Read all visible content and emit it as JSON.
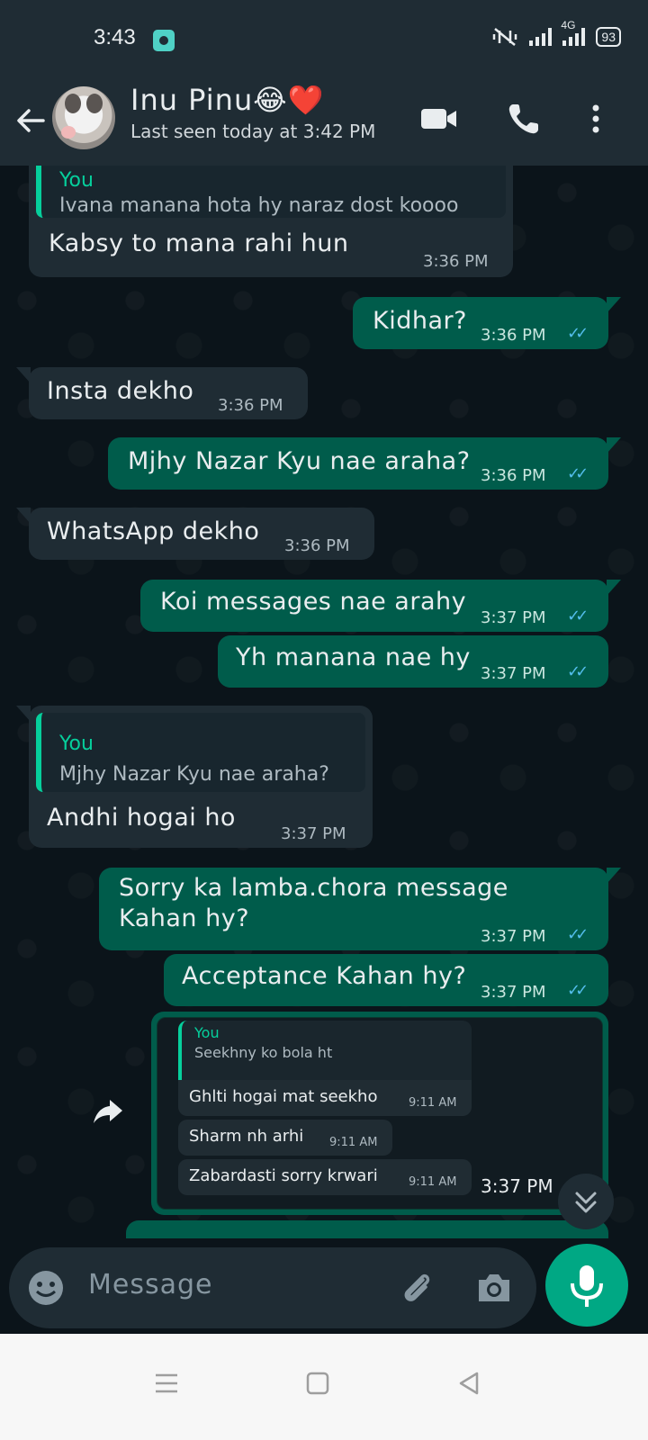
{
  "status_bar": {
    "time": "3:43",
    "network": "4G",
    "battery": "93"
  },
  "header": {
    "contact_name": "Inu Pinu😂❤️",
    "last_seen": "Last seen today at 3:42 PM",
    "icons": [
      "back-arrow-icon",
      "video-call-icon",
      "voice-call-icon",
      "more-options-icon"
    ]
  },
  "messages": [
    {
      "dir": "in",
      "quote_author": "You",
      "quote_text": "Ivana manana hota hy naraz dost koooo",
      "text": "Kabsy to mana rahi hun",
      "time": "3:36 PM"
    },
    {
      "dir": "out",
      "text": "Kidhar?",
      "time": "3:36 PM"
    },
    {
      "dir": "in",
      "text": "Insta dekho",
      "time": "3:36 PM"
    },
    {
      "dir": "out",
      "text": "Mjhy Nazar Kyu nae araha?",
      "time": "3:36 PM"
    },
    {
      "dir": "in",
      "text": "WhatsApp dekho",
      "time": "3:36 PM"
    },
    {
      "dir": "out",
      "text": "Koi messages nae arahy",
      "time": "3:37 PM"
    },
    {
      "dir": "out",
      "text": "Yh manana nae hy",
      "time": "3:37 PM"
    },
    {
      "dir": "in",
      "quote_author": "You",
      "quote_text": "Mjhy Nazar Kyu nae araha?",
      "text": "Andhi hogai ho",
      "time": "3:37 PM"
    },
    {
      "dir": "out",
      "text_line1": "Sorry ka lamba.chora message",
      "text_line2": "Kahan hy?",
      "time": "3:37 PM"
    },
    {
      "dir": "out",
      "text": "Acceptance Kahan hy?",
      "time": "3:37 PM"
    }
  ],
  "image_message": {
    "time": "3:37 PM",
    "quote_author": "You",
    "quote_text": "Seekhny ko bola ht",
    "inner": [
      {
        "text": "Ghlti hogai mat seekho",
        "time": "9:11 AM"
      },
      {
        "text": "Sharm nh arhi",
        "time": "9:11 AM"
      },
      {
        "text": "Zabardasti sorry krwari",
        "time": "9:11 AM"
      }
    ]
  },
  "input": {
    "placeholder": "Message"
  },
  "colors": {
    "background": "#0b141a",
    "incoming": "#1f2c34",
    "outgoing": "#005c4b",
    "accent": "#00a884",
    "read_tick": "#53bdeb"
  }
}
